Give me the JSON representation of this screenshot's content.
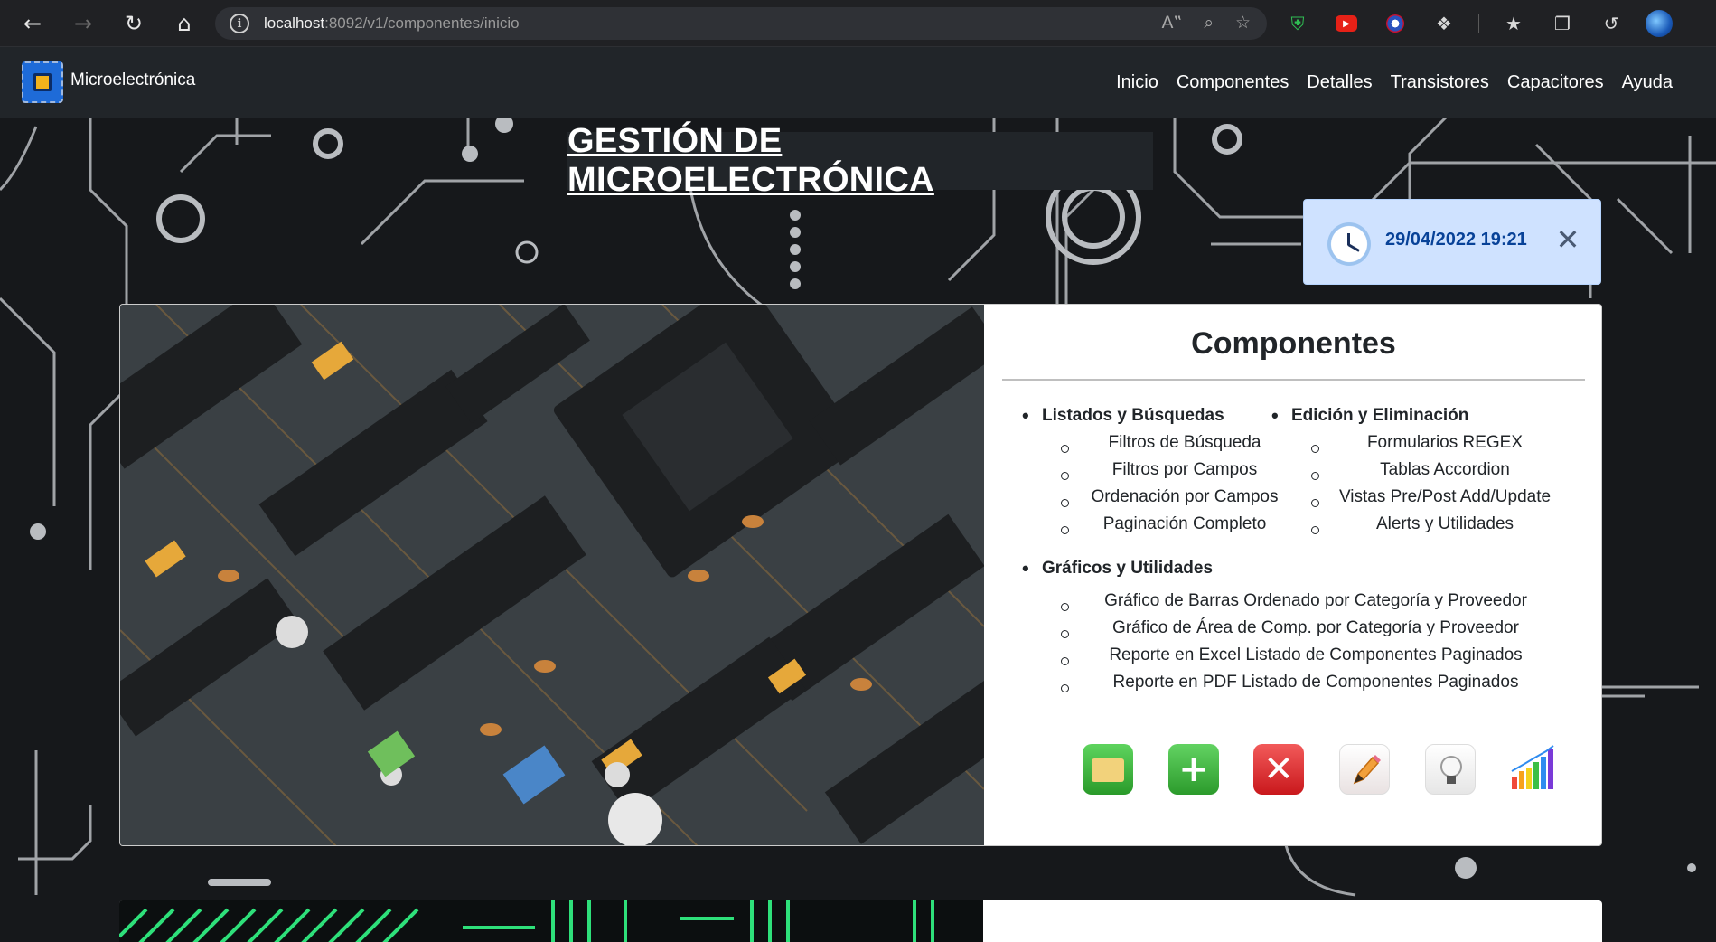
{
  "browser": {
    "url_host": "localhost",
    "url_path": ":8092/v1/componentes/inicio",
    "back_icon": "arrow-left-icon",
    "forward_icon": "arrow-right-icon",
    "refresh_icon": "refresh-icon",
    "home_icon": "home-icon"
  },
  "site": {
    "brand": "Microelectrónica",
    "nav": [
      "Inicio",
      "Componentes",
      "Detalles",
      "Transistores",
      "Capacitores",
      "Ayuda"
    ]
  },
  "page": {
    "title": "GESTIÓN DE MICROELECTRÓNICA"
  },
  "toast": {
    "datetime": "29/04/2022 19:21",
    "icon": "clock-icon"
  },
  "card": {
    "title": "Componentes",
    "sections": [
      {
        "title": "Listados y Búsquedas",
        "items": [
          "Filtros de Búsqueda",
          "Filtros por Campos",
          "Ordenación por Campos",
          "Paginación Completo"
        ]
      },
      {
        "title": "Edición y Eliminación",
        "items": [
          "Formularios REGEX",
          "Tablas Accordion",
          "Vistas Pre/Post Add/Update",
          "Alerts y Utilidades"
        ]
      },
      {
        "title": "Gráficos y Utilidades",
        "items": [
          "Gráfico de Barras Ordenado por Categoría y Proveedor",
          "Gráfico de Área de Comp. por Categoría y Proveedor",
          "Reporte en Excel Listado de Componentes Paginados",
          "Reporte en PDF Listado de Componentes Paginados"
        ]
      }
    ],
    "actions": [
      "folder-icon",
      "add-icon",
      "delete-icon",
      "edit-icon",
      "idea-icon",
      "chart-icon"
    ]
  },
  "colors": {
    "navbar": "#212529",
    "toast_bg": "#cfe2ff",
    "toast_text": "#084298"
  }
}
